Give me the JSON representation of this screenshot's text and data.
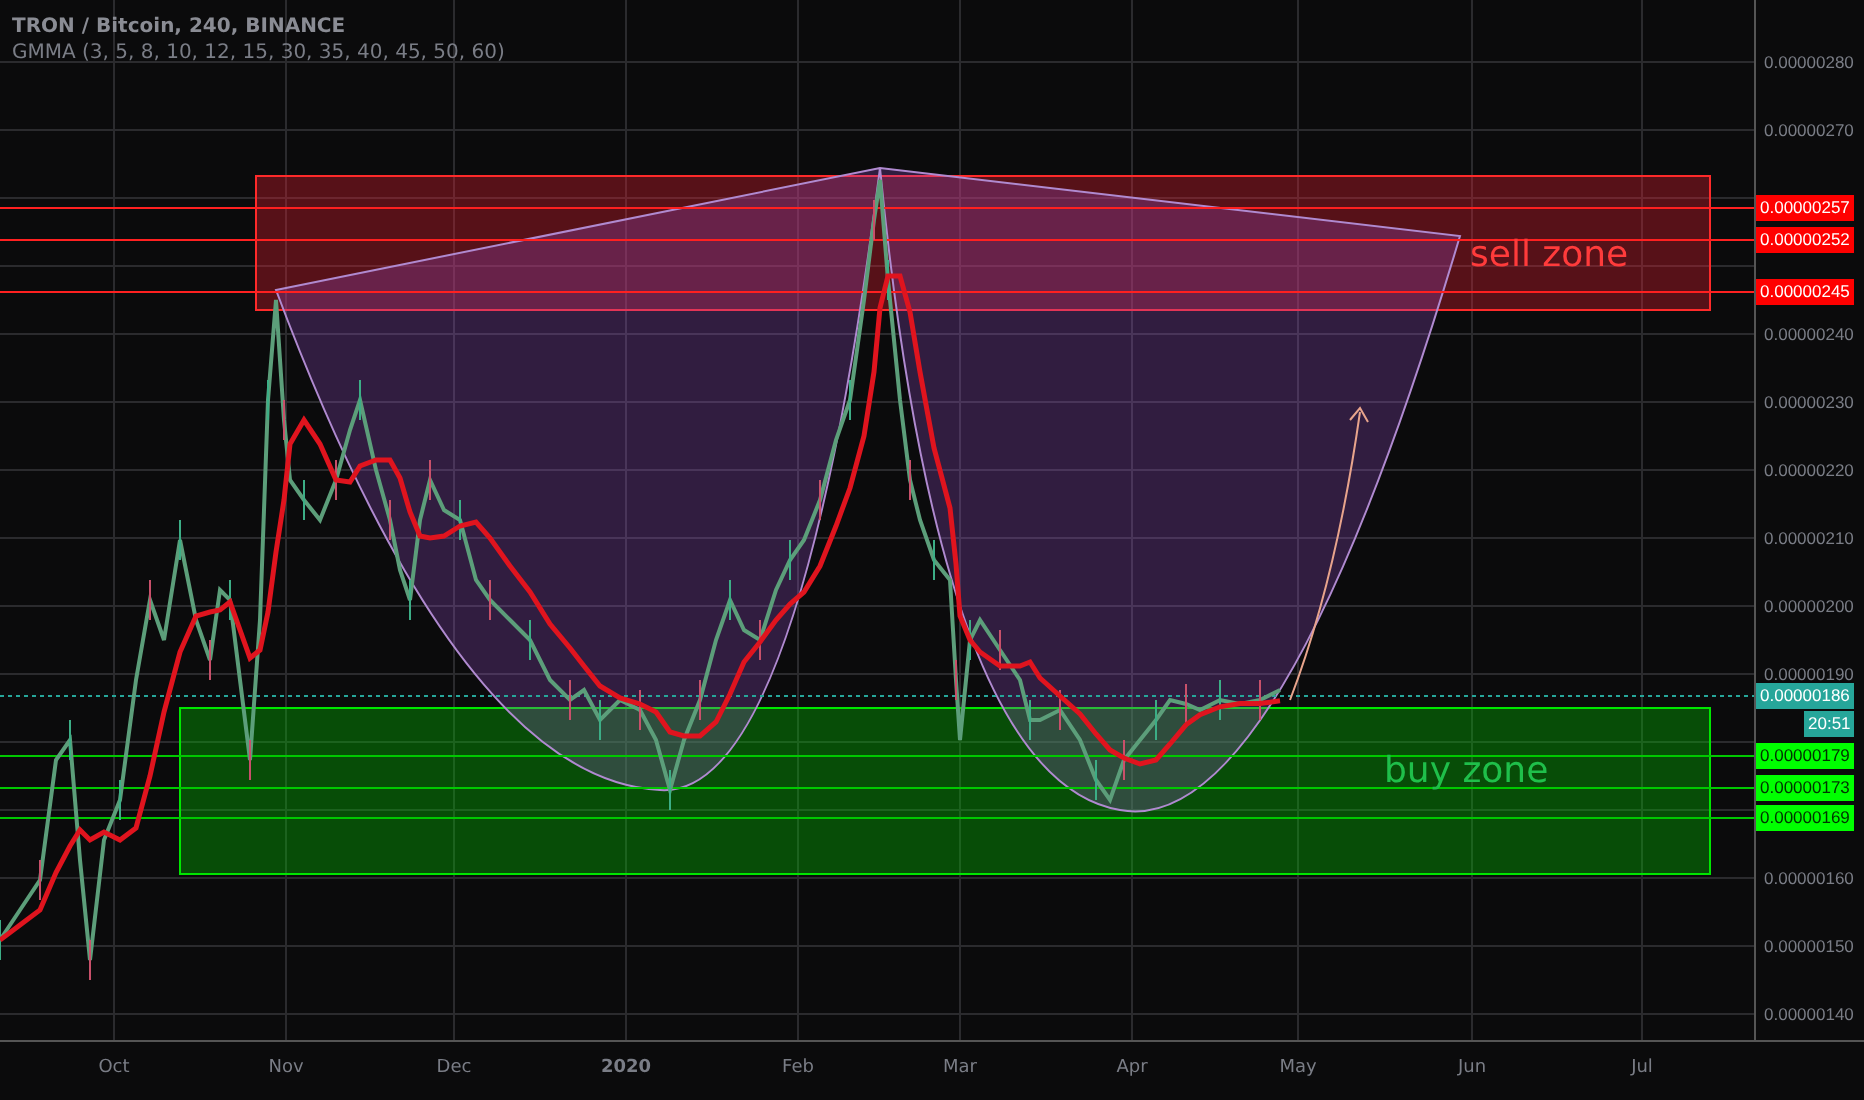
{
  "legend": {
    "title": "TRON / Bitcoin, 240, BINANCE",
    "indicator": "GMMA (3, 5, 8, 10, 12, 15, 30, 35, 40, 45, 50, 60)"
  },
  "zones": [
    {
      "kind": "sell",
      "label": "sell zone"
    },
    {
      "kind": "buy",
      "label": "buy zone"
    }
  ],
  "price_axis": {
    "ticks": [
      "0.00000280",
      "0.00000270",
      "0.00000240",
      "0.00000230",
      "0.00000220",
      "0.00000210",
      "0.00000200",
      "0.00000190",
      "0.00000160",
      "0.00000150",
      "0.00000140"
    ]
  },
  "price_badges": [
    {
      "kind": "sell",
      "text": "0.00000257"
    },
    {
      "kind": "sell",
      "text": "0.00000252"
    },
    {
      "kind": "sell",
      "text": "0.00000245"
    },
    {
      "kind": "last",
      "text": "0.00000186"
    },
    {
      "kind": "countdown",
      "text": "20:51"
    },
    {
      "kind": "buy",
      "text": "0.00000179"
    },
    {
      "kind": "buy",
      "text": "0.00000173"
    },
    {
      "kind": "buy",
      "text": "0.00000169"
    }
  ],
  "time_axis": [
    {
      "kind": "month",
      "text": "Oct"
    },
    {
      "kind": "month",
      "text": "Nov"
    },
    {
      "kind": "month",
      "text": "Dec"
    },
    {
      "kind": "year",
      "text": "2020"
    },
    {
      "kind": "month",
      "text": "Feb"
    },
    {
      "kind": "month",
      "text": "Mar"
    },
    {
      "kind": "month",
      "text": "Apr"
    },
    {
      "kind": "month",
      "text": "May"
    },
    {
      "kind": "month",
      "text": "Jun"
    },
    {
      "kind": "month",
      "text": "Jul"
    }
  ]
}
